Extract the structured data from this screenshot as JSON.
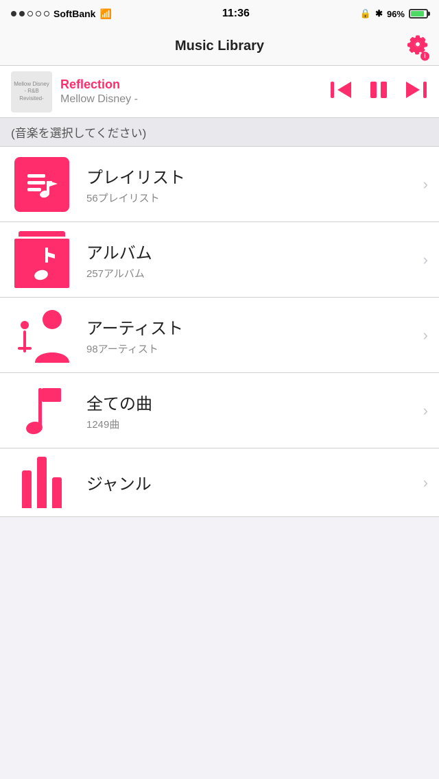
{
  "statusBar": {
    "carrier": "SoftBank",
    "time": "11:36",
    "battery": "96%"
  },
  "navBar": {
    "title": "Music Library",
    "gearBadge": "i"
  },
  "nowPlaying": {
    "albumArtText": "Mellow Disney - R&B Revisited-",
    "trackTitle": "Reflection",
    "trackArtist": "Mellow Disney -",
    "prevLabel": "⏮",
    "pauseLabel": "⏸",
    "nextLabel": "⏭"
  },
  "sectionHeader": "(音楽を選択してください)",
  "menuItems": [
    {
      "id": "playlist",
      "title": "プレイリスト",
      "subtitle": "56プレイリスト",
      "iconType": "playlist"
    },
    {
      "id": "album",
      "title": "アルバム",
      "subtitle": "257アルバム",
      "iconType": "album"
    },
    {
      "id": "artist",
      "title": "アーティスト",
      "subtitle": "98アーティスト",
      "iconType": "artist"
    },
    {
      "id": "songs",
      "title": "全ての曲",
      "subtitle": "1249曲",
      "iconType": "songs"
    },
    {
      "id": "genre",
      "title": "ジャンル",
      "subtitle": "",
      "iconType": "genre"
    }
  ],
  "chevron": "›"
}
